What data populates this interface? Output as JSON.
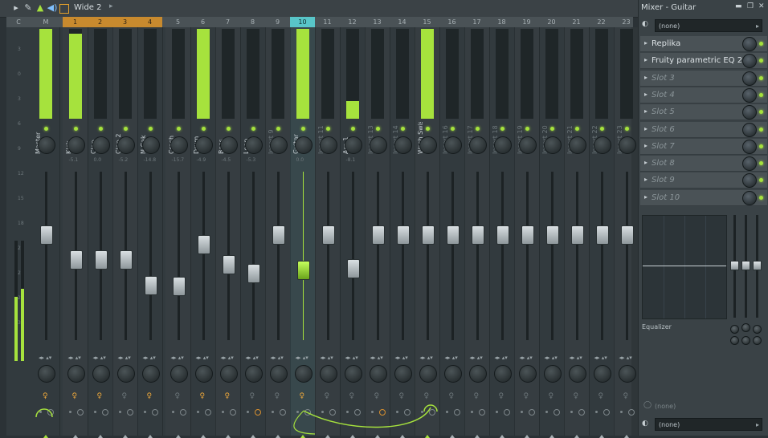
{
  "toolbar": {
    "title": "Wide 2",
    "icons": [
      "play-menu-icon",
      "pen-icon",
      "pointer-icon",
      "speaker-icon",
      "window-icon"
    ]
  },
  "mixer": {
    "header_cells": [
      {
        "label": "C",
        "selected": false,
        "orange": false
      },
      {
        "label": "M",
        "selected": false,
        "orange": false
      },
      {
        "label": "1",
        "selected": false,
        "orange": true
      },
      {
        "label": "2",
        "selected": false,
        "orange": true
      },
      {
        "label": "3",
        "selected": false,
        "orange": true
      },
      {
        "label": "4",
        "selected": false,
        "orange": true
      },
      {
        "label": "5",
        "selected": false,
        "orange": false
      },
      {
        "label": "6",
        "selected": false,
        "orange": false
      },
      {
        "label": "7",
        "selected": false,
        "orange": false
      },
      {
        "label": "8",
        "selected": false,
        "orange": false
      },
      {
        "label": "9",
        "selected": false,
        "orange": false
      },
      {
        "label": "10",
        "selected": true,
        "orange": false
      },
      {
        "label": "11",
        "selected": false,
        "orange": false
      },
      {
        "label": "12",
        "selected": false,
        "orange": false
      },
      {
        "label": "13",
        "selected": false,
        "orange": false
      },
      {
        "label": "14",
        "selected": false,
        "orange": false
      },
      {
        "label": "15",
        "selected": false,
        "orange": false
      },
      {
        "label": "16",
        "selected": false,
        "orange": false
      },
      {
        "label": "17",
        "selected": false,
        "orange": false
      },
      {
        "label": "18",
        "selected": false,
        "orange": false
      },
      {
        "label": "19",
        "selected": false,
        "orange": false
      },
      {
        "label": "20",
        "selected": false,
        "orange": false
      },
      {
        "label": "21",
        "selected": false,
        "orange": false
      },
      {
        "label": "22",
        "selected": false,
        "orange": false
      },
      {
        "label": "23",
        "selected": false,
        "orange": false
      }
    ],
    "channels": [
      {
        "name": "Master",
        "meter": 1.0,
        "fader": 0.88,
        "pan": "",
        "dim": false
      },
      {
        "name": "Kick",
        "meter": 0.95,
        "fader": 0.67,
        "pan": "-5.1",
        "dim": false
      },
      {
        "name": "Clap",
        "meter": 0.0,
        "fader": 0.67,
        "pan": "0.0",
        "dim": false
      },
      {
        "name": "Clap 2",
        "meter": 0.0,
        "fader": 0.67,
        "pan": "-5.2",
        "dim": false
      },
      {
        "name": "N Cak",
        "meter": 0.0,
        "fader": 0.45,
        "pan": "-14.8",
        "dim": false
      },
      {
        "name": "Crash",
        "meter": 0.0,
        "fader": 0.44,
        "pan": "-15.7",
        "dim": false
      },
      {
        "name": "Drum",
        "meter": 1.0,
        "fader": 0.8,
        "pan": "-4.9",
        "dim": false
      },
      {
        "name": "Bass",
        "meter": 0.0,
        "fader": 0.63,
        "pan": "-4.5",
        "dim": false
      },
      {
        "name": "Loop",
        "meter": 0.0,
        "fader": 0.55,
        "pan": "-5.3",
        "dim": false
      },
      {
        "name": "Insert 9",
        "meter": 0.0,
        "fader": 0.88,
        "pan": "",
        "dim": true
      },
      {
        "name": "Guitar",
        "meter": 1.0,
        "fader": 0.58,
        "pan": "0.0",
        "dim": false
      },
      {
        "name": "Insert 11",
        "meter": 0.0,
        "fader": 0.88,
        "pan": "",
        "dim": true
      },
      {
        "name": "Arp 1",
        "meter": 0.2,
        "fader": 0.59,
        "pan": "-8.1",
        "dim": false
      },
      {
        "name": "Insert 13",
        "meter": 0.0,
        "fader": 0.88,
        "pan": "",
        "dim": true
      },
      {
        "name": "Insert 14",
        "meter": 0.0,
        "fader": 0.88,
        "pan": "",
        "dim": true
      },
      {
        "name": "Wash Swish",
        "meter": 1.0,
        "fader": 0.88,
        "pan": "",
        "dim": false
      },
      {
        "name": "Insert 16",
        "meter": 0.0,
        "fader": 0.88,
        "pan": "",
        "dim": true
      },
      {
        "name": "Insert 17",
        "meter": 0.0,
        "fader": 0.88,
        "pan": "",
        "dim": true
      },
      {
        "name": "Insert 18",
        "meter": 0.0,
        "fader": 0.88,
        "pan": "",
        "dim": true
      },
      {
        "name": "Insert 19",
        "meter": 0.0,
        "fader": 0.88,
        "pan": "",
        "dim": true
      },
      {
        "name": "Insert 20",
        "meter": 0.0,
        "fader": 0.88,
        "pan": "",
        "dim": true
      },
      {
        "name": "Insert 21",
        "meter": 0.0,
        "fader": 0.88,
        "pan": "",
        "dim": true
      },
      {
        "name": "Insert 22",
        "meter": 0.0,
        "fader": 0.88,
        "pan": "",
        "dim": true
      },
      {
        "name": "Insert 23",
        "meter": 0.0,
        "fader": 0.88,
        "pan": "",
        "dim": true
      }
    ]
  },
  "panel": {
    "title": "Mixer - Guitar",
    "input_select": "(none)",
    "slots": [
      {
        "label": "Replika",
        "empty": false
      },
      {
        "label": "Fruity parametric EQ 2",
        "empty": false
      },
      {
        "label": "Slot 3",
        "empty": true
      },
      {
        "label": "Slot 4",
        "empty": true
      },
      {
        "label": "Slot 5",
        "empty": true
      },
      {
        "label": "Slot 6",
        "empty": true
      },
      {
        "label": "Slot 7",
        "empty": true
      },
      {
        "label": "Slot 8",
        "empty": true
      },
      {
        "label": "Slot 9",
        "empty": true
      },
      {
        "label": "Slot 10",
        "empty": true
      }
    ],
    "eq_label": "Equalizer",
    "bottom_none_1": "(none)",
    "output_select": "(none)"
  },
  "colors": {
    "accent_green": "#a6e23d",
    "selected_teal": "#58c5c8",
    "orange": "#c88a2e"
  }
}
